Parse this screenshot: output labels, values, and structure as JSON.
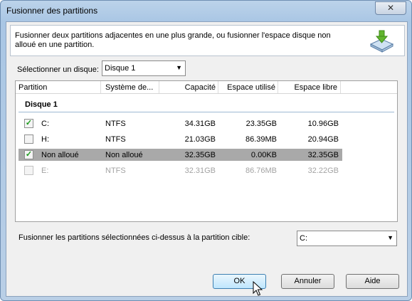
{
  "window": {
    "title": "Fusionner des partitions",
    "close_glyph": "✕"
  },
  "description": "Fusionner deux partitions adjacentes en une plus grande, ou fusionner l'espace disque non alloué en une partition.",
  "disk_select": {
    "label": "Sélectionner un disque:",
    "value": "Disque 1"
  },
  "columns": [
    "Partition",
    "Système de...",
    "Capacité",
    "Espace utilisé",
    "Espace libre"
  ],
  "group": "Disque 1",
  "rows": [
    {
      "checked": true,
      "name": "C:",
      "fs": "NTFS",
      "capacity": "34.31GB",
      "used": "23.35GB",
      "free": "10.96GB"
    },
    {
      "checked": false,
      "name": "H:",
      "fs": "NTFS",
      "capacity": "21.03GB",
      "used": "86.39MB",
      "free": "20.94GB"
    },
    {
      "checked": true,
      "name": "Non alloué",
      "fs": "Non alloué",
      "capacity": "32.35GB",
      "used": "0.00KB",
      "free": "32.35GB"
    },
    {
      "checked": false,
      "name": "E:",
      "fs": "NTFS",
      "capacity": "32.31GB",
      "used": "86.76MB",
      "free": "32.22GB"
    }
  ],
  "target": {
    "label": "Fusionner les partitions sélectionnées ci-dessus à la partition cible:",
    "value": "C:"
  },
  "buttons": {
    "ok": "OK",
    "cancel": "Annuler",
    "help": "Aide"
  },
  "icons": {
    "dropdown": "▼",
    "check": "✓"
  }
}
